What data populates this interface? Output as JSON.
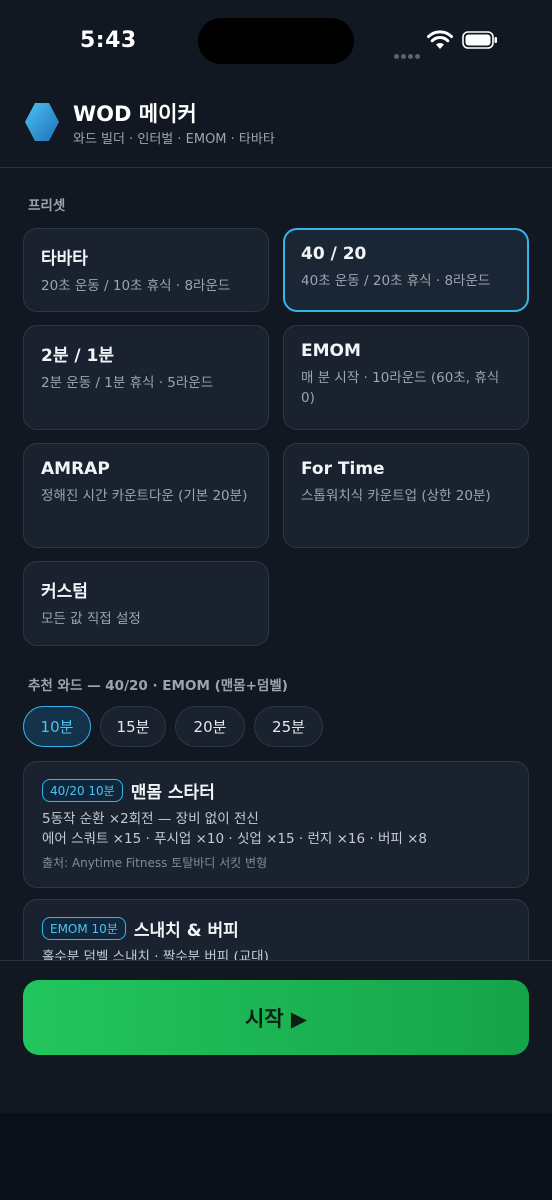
{
  "status": {
    "time": "5:43"
  },
  "header": {
    "title": "WOD 메이커",
    "subtitle": "와드 빌더 · 인터벌 · EMOM · 타바타"
  },
  "presets_label": "프리셋",
  "presets": [
    {
      "name": "타바타",
      "desc": "20초 운동 / 10초 휴식 · 8라운드",
      "selected": false
    },
    {
      "name": "40 / 20",
      "desc": "40초 운동 / 20초 휴식 · 8라운드",
      "selected": true
    },
    {
      "name": "2분 / 1분",
      "desc": "2분 운동 / 1분 휴식 · 5라운드",
      "selected": false
    },
    {
      "name": "EMOM",
      "desc": "매 분 시작 · 10라운드 (60초, 휴식 0)",
      "selected": false
    },
    {
      "name": "AMRAP",
      "desc": "정해진 시간 카운트다운 (기본 20분)",
      "selected": false
    },
    {
      "name": "For Time",
      "desc": "스톱워치식 카운트업 (상한 20분)",
      "selected": false
    },
    {
      "name": "커스텀",
      "desc": "모든 값 직접 설정",
      "selected": false
    }
  ],
  "recommend_label": "추천 와드 — 40/20 · EMOM (맨몸+덤벨)",
  "durations": [
    {
      "label": "10분",
      "active": true
    },
    {
      "label": "15분",
      "active": false
    },
    {
      "label": "20분",
      "active": false
    },
    {
      "label": "25분",
      "active": false
    }
  ],
  "wods": [
    {
      "badge": "40/20 10분",
      "title": "맨몸 스타터",
      "line1": "5동작 순환 ×2회전 — 장비 없이 전신",
      "line2": "에어 스쿼트 ×15 · 푸시업 ×10 · 싯업 ×15 · 런지 ×16 · 버피 ×8",
      "source": "출처: Anytime Fitness 토탈바디 서킷 변형"
    },
    {
      "badge": "EMOM 10분",
      "title": "스내치 & 버피",
      "line1": "홀수분 덤벨 스내치 · 짝수분 버피 (교대)"
    }
  ],
  "start_button": "시작 ▶",
  "colors": {
    "accent": "#38b4ec",
    "start": "#22c55e",
    "background": "#111821"
  }
}
